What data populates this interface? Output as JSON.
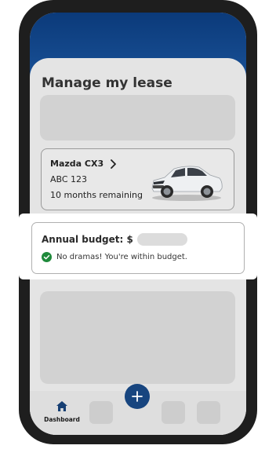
{
  "page": {
    "title": "Manage my lease"
  },
  "vehicle": {
    "name": "Mazda CX3",
    "plate": "ABC 123",
    "remaining": "10 months remaining",
    "icon": "chevron-right-icon"
  },
  "budget": {
    "title": "Annual budget: $",
    "status": "No dramas! You're within budget.",
    "status_color": "#1f8a3b"
  },
  "nav": {
    "dashboard_label": "Dashboard",
    "fab_icon": "plus-icon"
  },
  "colors": {
    "brand_dark": "#0b3a7a",
    "brand_fab": "#17457f",
    "success": "#1f8a3b"
  }
}
